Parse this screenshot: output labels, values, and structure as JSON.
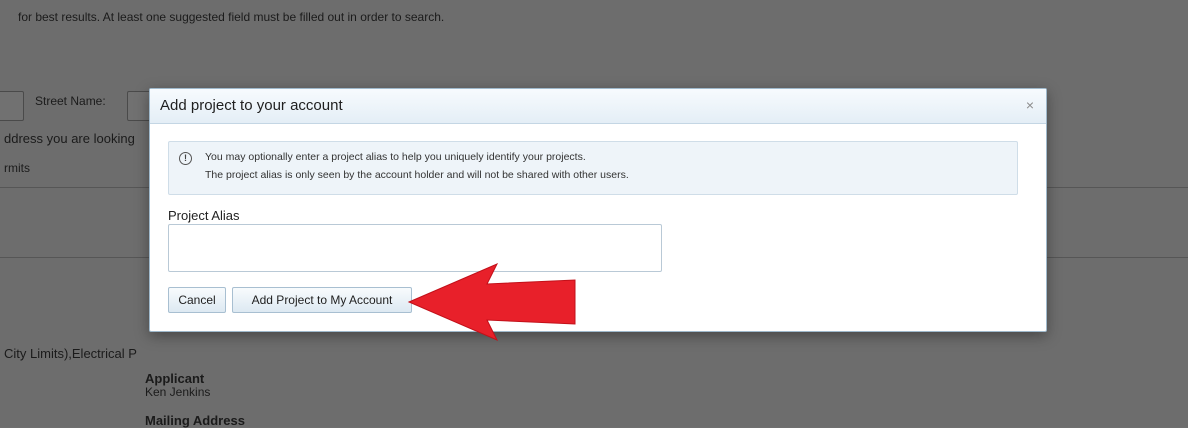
{
  "background": {
    "hint_text": "for best results. At least one suggested field must be filled out in order to search.",
    "street_name_label": "Street Name:",
    "address_text": "ddress you are looking",
    "permits_text": "rmits",
    "city_limits_text": "City Limits),Electrical P",
    "applicant_label": "Applicant",
    "applicant_name": "Ken Jenkins",
    "mailing_address_label": "Mailing Address"
  },
  "modal": {
    "title": "Add project to your account",
    "close_symbol": "×",
    "info_icon": "!",
    "info_line1": "You may optionally enter a project alias to help you uniquely identify your projects.",
    "info_line2": "The project alias is only seen by the account holder and will not be shared with other users.",
    "alias_label": "Project Alias",
    "alias_value": "",
    "cancel_label": "Cancel",
    "add_label": "Add Project to My Account"
  },
  "colors": {
    "accent_arrow": "#e8202a",
    "modal_border": "#9fb9cc",
    "overlay": "#6d6d6d"
  }
}
